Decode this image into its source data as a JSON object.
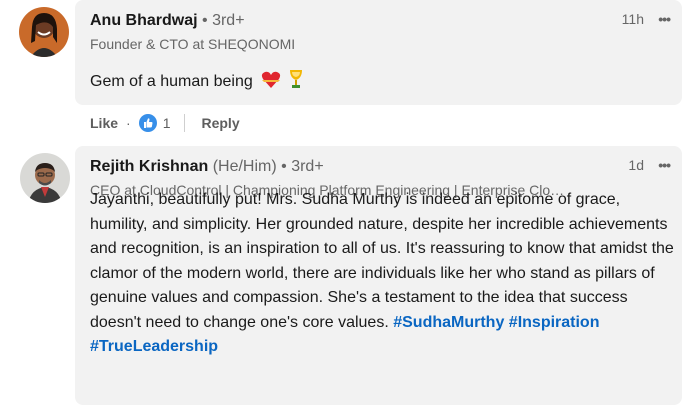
{
  "comments": [
    {
      "author": "Anu Bhardwaj",
      "pronouns": "",
      "degree": "• 3rd+",
      "headline": "Founder & CTO at SHEQONOMI",
      "time": "11h",
      "text": "Gem of a human being",
      "emojis": [
        "heart-with-ribbon",
        "trophy-cup"
      ],
      "actions": {
        "like": "Like",
        "like_count": "1",
        "reply": "Reply"
      }
    },
    {
      "author": "Rejith Krishnan",
      "pronouns": "(He/Him)",
      "degree": "• 3rd+",
      "headline": "CEO at CloudControl | Championing Platform Engineering | Enterprise Clo…",
      "time": "1d",
      "text": "Jayanthi, beautifully put! Mrs. Sudha Murthy is indeed an epitome of grace, humility, and simplicity. Her grounded nature, despite her incredible achievements and recognition, is an inspiration to all of us. It's reassuring to know that amidst the clamor of the modern world, there are individuals like her who stand as pillars of genuine values and compassion. She's a testament to the idea that success doesn't need to change one's core values.",
      "hashtags": [
        "#SudhaMurthy",
        "#Inspiration",
        "#TrueLeadership"
      ]
    }
  ],
  "colors": {
    "accent": "#0a66c2",
    "bubble": "#f2f2f2",
    "secondary_text": "#666666"
  }
}
